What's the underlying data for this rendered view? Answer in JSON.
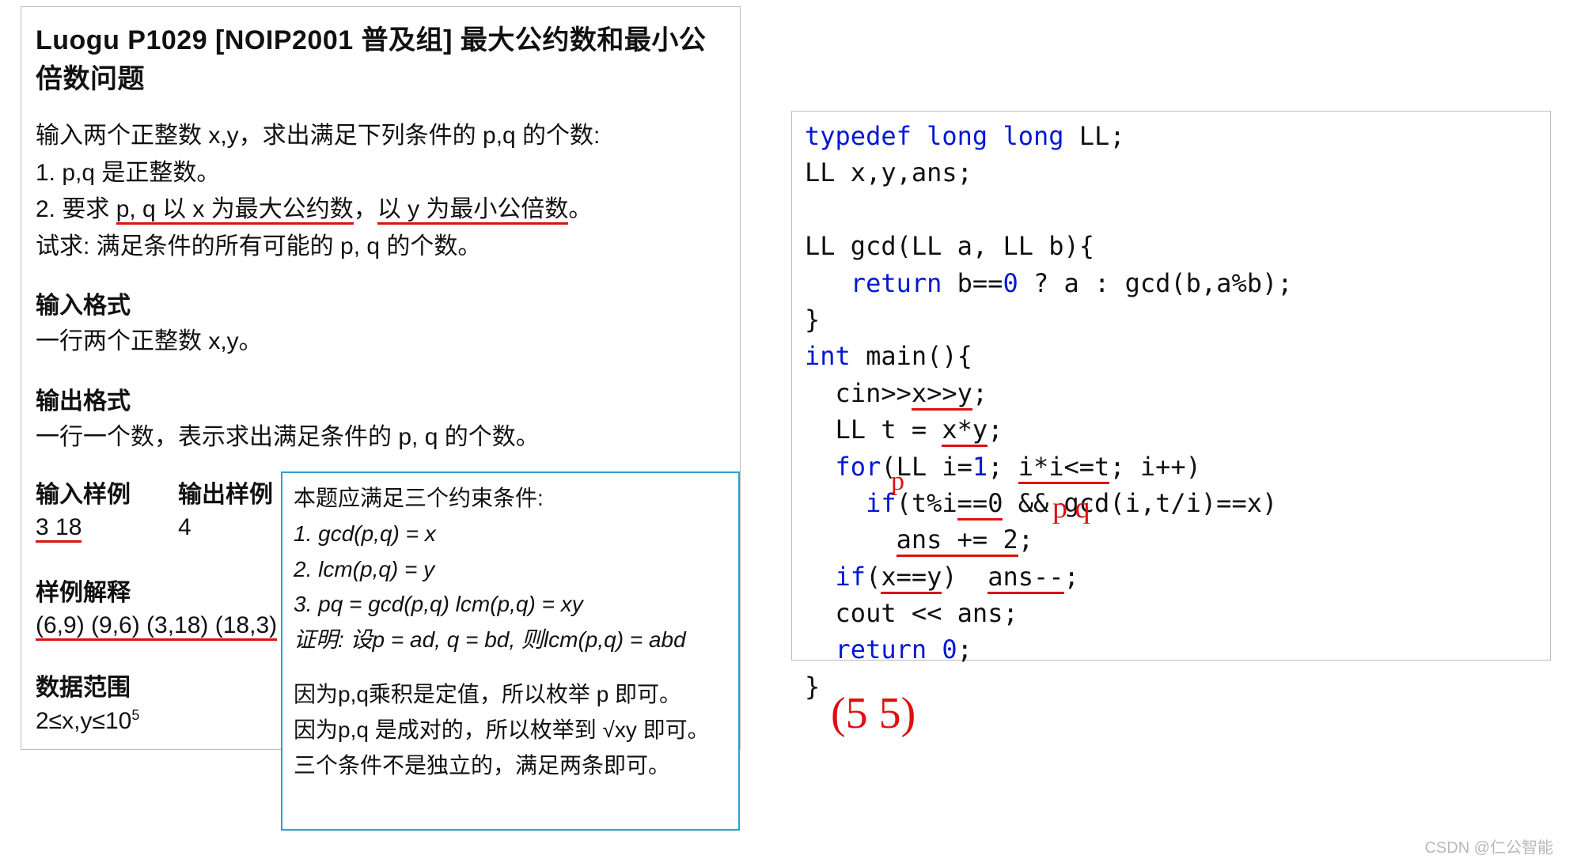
{
  "problem": {
    "title": "Luogu P1029 [NOIP2001 普及组] 最大公约数和最小公倍数问题",
    "intro": "输入两个正整数 x,y，求出满足下列条件的 p,q 的个数:",
    "cond1": "1. p,q 是正整数。",
    "cond2a": "2. 要求 ",
    "cond2b": "p, q 以 x 为最大公约数",
    "cond2c": "，",
    "cond2d": "以 y 为最小公倍数",
    "cond2e": "。",
    "ask": "试求:  满足条件的所有可能的 p, q 的个数。",
    "input_h": "输入格式",
    "input_b": "一行两个正整数 x,y。",
    "output_h": "输出格式",
    "output_b": "一行一个数，表示求出满足条件的 p, q 的个数。",
    "samp_in_h": "输入样例",
    "samp_in_v": "3  18",
    "samp_out_h": "输出样例",
    "samp_out_v": "4",
    "explain_h": "样例解释",
    "explain_v": "(6,9) (9,6) (3,18) (18,3)",
    "range_h": "数据范围",
    "range_v": "2≤x,y≤10⁵"
  },
  "analysis": {
    "l1": "本题应满足三个约束条件:",
    "l2": "1.  gcd(p,q) = x",
    "l3": "2.  lcm(p,q) = y",
    "l4": "3.  pq = gcd(p,q) lcm(p,q) = xy",
    "l5": "证明:  设p = ad, q = bd, 则lcm(p,q) = abd",
    "l6": "因为p,q乘积是定值，所以枚举 p 即可。",
    "l7": "因为p,q 是成对的，所以枚举到 √xy 即可。",
    "l8": "三个条件不是独立的，满足两条即可。"
  },
  "code": {
    "l1a": "typedef long long",
    "l1b": " LL;",
    "l2": "LL x,y,ans;",
    "l3": "",
    "l4": "LL gcd(LL a, LL b){",
    "l5a": "   ",
    "l5b": "return",
    "l5c": " b==",
    "l5d": "0",
    "l5e": " ? a : gcd(b,a%b);",
    "l6": "}",
    "l7a": "int",
    "l7b": " main(){",
    "l8a": "  cin>>",
    "l8b": "x>>y",
    "l8c": ";",
    "l9a": "  LL t = ",
    "l9b": "x*y",
    "l9c": ";",
    "l10a": "  ",
    "l10b": "for",
    "l10c": "(LL i=",
    "l10d": "1",
    "l10e": "; ",
    "l10f": "i*i<=t",
    "l10g": "; i++)",
    "l11a": "    ",
    "l11b": "if",
    "l11c": "(t%i",
    "l11d": "==0",
    "l11e": " && gcd(i,t/i)==x)",
    "l12a": "      ",
    "l12b": "ans += 2",
    "l12c": ";",
    "l13a": "  ",
    "l13b": "if",
    "l13c": "(",
    "l13d": "x==y",
    "l13e": ")  ",
    "l13f": "ans--",
    "l13g": ";",
    "l14": "  cout << ans;",
    "l15a": "  ",
    "l15b": "return",
    "l15c": " ",
    "l15d": "0",
    "l15e": ";",
    "l16": "}"
  },
  "handwriting": {
    "p": "p",
    "pq": "p  q",
    "pair": "(5  5)"
  },
  "watermark": "CSDN @仁公智能"
}
